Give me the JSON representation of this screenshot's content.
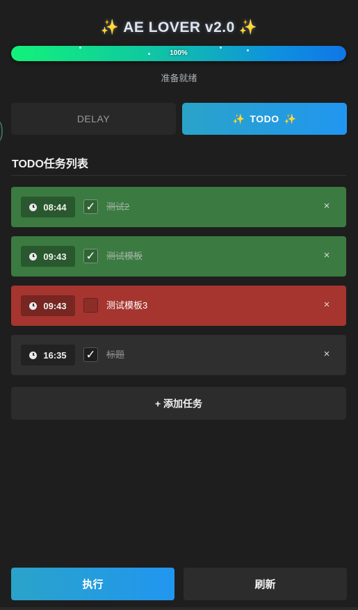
{
  "header": {
    "spark_left": "✨",
    "title": "AE LOVER v2.0",
    "spark_right": "✨"
  },
  "progress": {
    "value": 1.0,
    "label": "100%"
  },
  "status_text": "准备就绪",
  "tabs": {
    "delay_label": "DELAY",
    "todo_spark_left": "✨",
    "todo_label": "TODO",
    "todo_spark_right": "✨",
    "active": "TODO"
  },
  "section_title": "TODO任务列表",
  "tasks": [
    {
      "time": "08:44",
      "checked": true,
      "check_glyph": "✓",
      "label": "测试2",
      "status": "done",
      "color": "#3b7a41",
      "remove_glyph": "×"
    },
    {
      "time": "09:43",
      "checked": true,
      "check_glyph": "✓",
      "label": "测试模板",
      "status": "done",
      "color": "#3b7a41",
      "remove_glyph": "×"
    },
    {
      "time": "09:43",
      "checked": false,
      "check_glyph": "",
      "label": "测试模板3",
      "status": "overdue",
      "color": "#a5352e",
      "remove_glyph": "×"
    },
    {
      "time": "16:35",
      "checked": true,
      "check_glyph": "✓",
      "label": "标题",
      "status": "done",
      "color": "#2f2f2f",
      "remove_glyph": "×"
    }
  ],
  "add_task_label": "+ 添加任务",
  "footer": {
    "execute_label": "执行",
    "refresh_label": "刷新"
  },
  "colors": {
    "accent_gradient_start": "#2aa3c9",
    "accent_gradient_end": "#2196f0",
    "progress_start": "#12f27a",
    "progress_end": "#1076e6",
    "background": "#1e1e1e"
  }
}
